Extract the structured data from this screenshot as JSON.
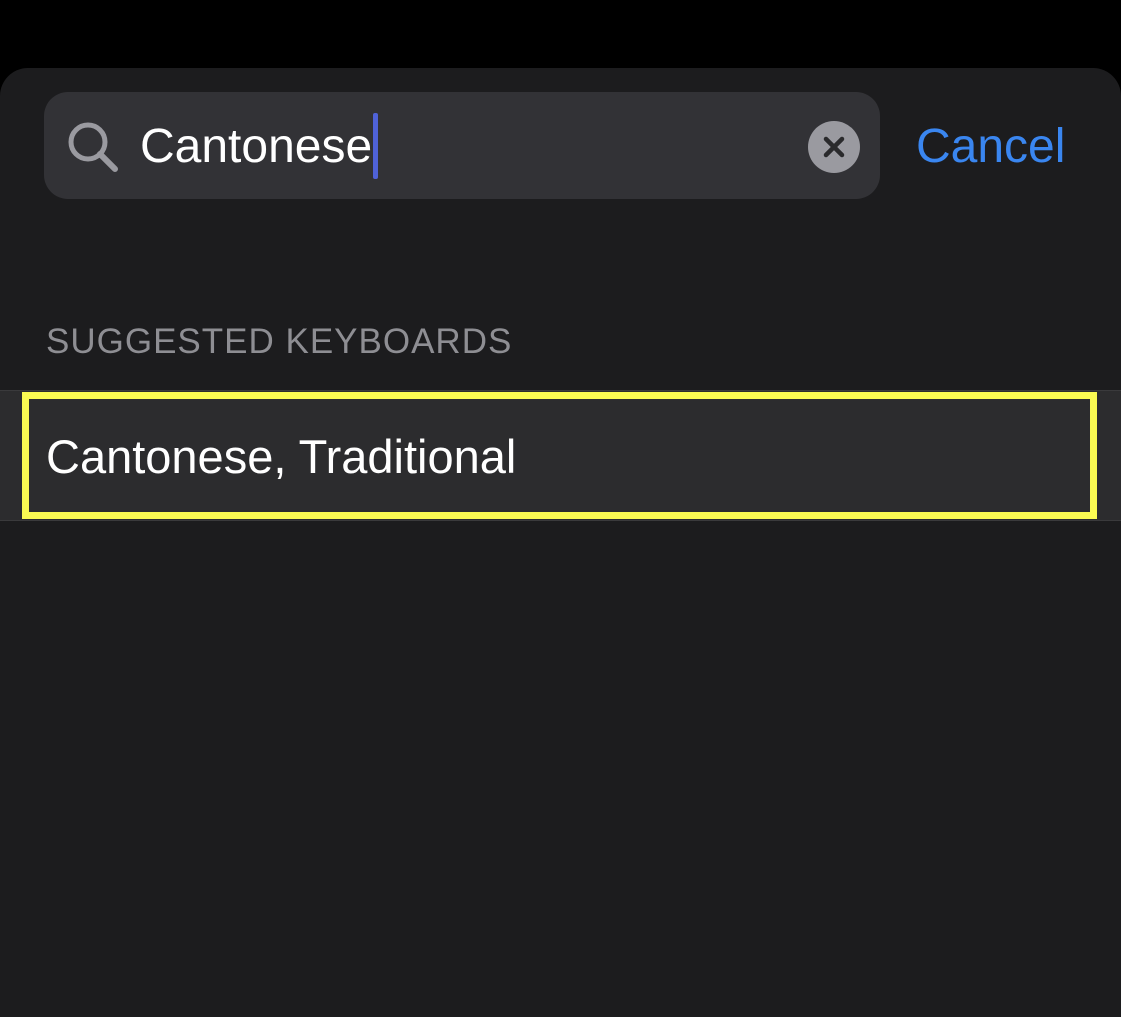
{
  "search": {
    "value": "Cantonese",
    "icon": "search-icon",
    "clear_icon": "clear-icon",
    "caret_color": "#4f62d8"
  },
  "cancel_label": "Cancel",
  "section": {
    "header": "SUGGESTED KEYBOARDS",
    "items": [
      {
        "label": "Cantonese, Traditional",
        "highlighted": true
      }
    ]
  },
  "colors": {
    "background": "#000000",
    "sheet": "#1c1c1e",
    "search_field": "#323236",
    "row": "#2c2c2e",
    "accent": "#3a86f0",
    "highlight": "#fbfb52",
    "secondary_text": "#8e8e93"
  }
}
